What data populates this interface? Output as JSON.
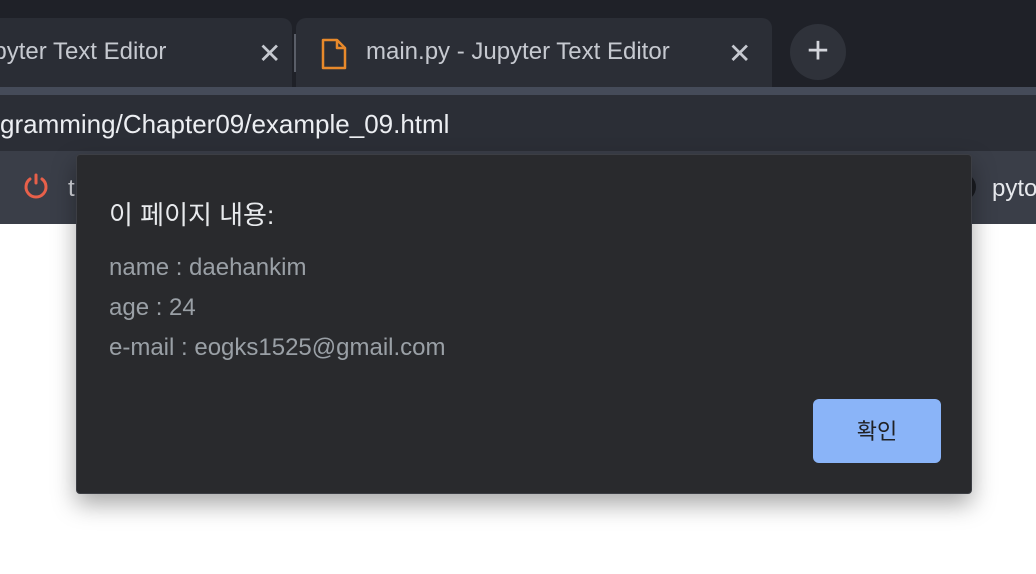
{
  "tabs": [
    {
      "title": "upyter Text Editor",
      "close_icon": "close-icon"
    },
    {
      "title": "main.py - Jupyter Text Editor",
      "icon": "file-icon",
      "close_icon": "close-icon"
    }
  ],
  "new_tab": {
    "icon": "plus-icon"
  },
  "address_bar": {
    "url": "gramming/Chapter09/example_09.html"
  },
  "bookmarks": {
    "left_item": {
      "icon": "power-icon",
      "label": "t"
    },
    "right_item": {
      "label": "pyto"
    }
  },
  "dialog": {
    "title": "이 페이지 내용:",
    "lines": [
      "name : daehankim",
      "age : 24",
      "e-mail : eogks1525@gmail.com"
    ],
    "ok_label": "확인"
  },
  "colors": {
    "tab_strip": "#1f2128",
    "dialog_bg": "#292a2d",
    "button_accent": "#8ab4f8",
    "file_icon": "#e8892b",
    "power_icon": "#e8604a"
  }
}
